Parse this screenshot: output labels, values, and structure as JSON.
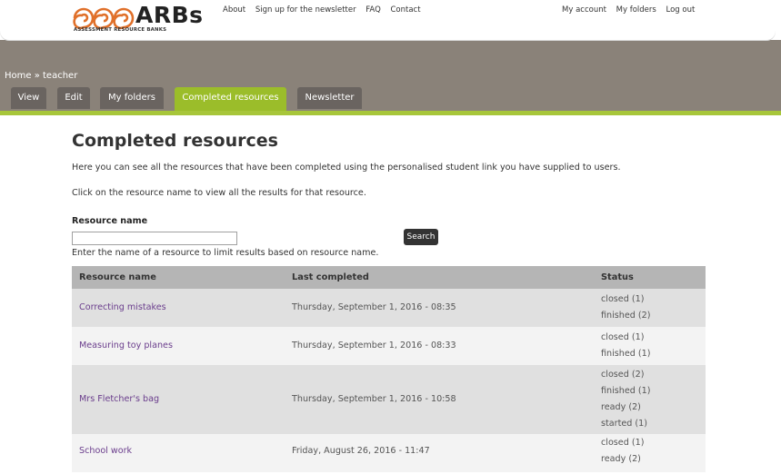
{
  "logo": {
    "text": "ARBs",
    "subtitle": "ASSESSMENT RESOURCE BANKS",
    "accent": "#e0702a"
  },
  "topnav_left": [
    "About",
    "Sign up for the newsletter",
    "FAQ",
    "Contact"
  ],
  "topnav_right": [
    "My account",
    "My folders",
    "Log out"
  ],
  "breadcrumb": "Home » teacher",
  "tabs": [
    "View",
    "Edit",
    "My folders",
    "Completed resources",
    "Newsletter"
  ],
  "active_tab": "Completed resources",
  "page": {
    "title": "Completed resources",
    "intro": "Here you can see all the resources that have been completed using the personalised student link you have supplied to users.",
    "instruction": "Click on the resource name to view all the results for that resource."
  },
  "filter": {
    "label": "Resource name",
    "value": "",
    "description": "Enter the name of a resource to limit results based on resource name.",
    "button": "Search"
  },
  "table": {
    "headers": [
      "Resource name",
      "Last completed",
      "Status"
    ],
    "rows": [
      {
        "name": "Correcting mistakes",
        "date": "Thursday, September 1, 2016 - 08:35",
        "status": [
          "closed (1)",
          "finished (2)"
        ]
      },
      {
        "name": "Measuring toy planes",
        "date": "Thursday, September 1, 2016 - 08:33",
        "status": [
          "closed (1)",
          "finished (1)"
        ]
      },
      {
        "name": "Mrs Fletcher's bag",
        "date": "Thursday, September 1, 2016 - 10:58",
        "status": [
          "closed (2)",
          "finished (1)",
          "ready (2)",
          "started (1)"
        ]
      },
      {
        "name": "School work",
        "date": "Friday, August 26, 2016 - 11:47",
        "status": [
          "closed (1)",
          "ready (2)"
        ]
      }
    ]
  }
}
